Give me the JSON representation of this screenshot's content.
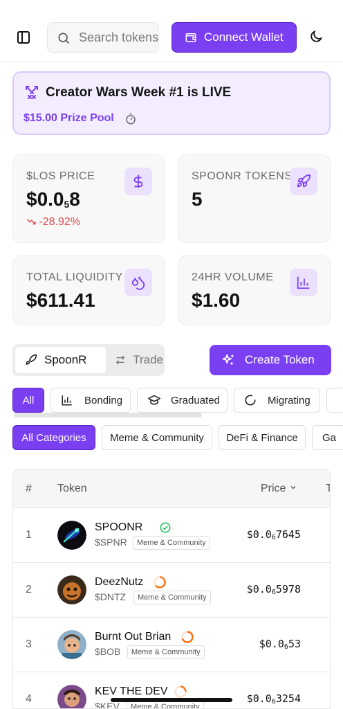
{
  "header": {
    "search_placeholder": "Search tokens",
    "connect_label": "Connect Wallet",
    "icons": [
      "sidebar-toggle-icon",
      "search-icon",
      "wallet-icon",
      "moon-icon"
    ]
  },
  "banner": {
    "title": "Creator Wars Week #1 is LIVE",
    "prize": "$15.00 Prize Pool",
    "icons": [
      "crossed-swords-icon",
      "timer-icon"
    ]
  },
  "stats": {
    "los_price": {
      "label": "$LOS PRICE",
      "value_prefix": "$0.0",
      "value_sub": "5",
      "value_suffix": "8",
      "change": "-28.92%",
      "icon": "dollar-icon"
    },
    "spoonr_tokens": {
      "label": "SPOONR TOKENS",
      "value": "5",
      "icon": "rocket-icon"
    },
    "total_liquidity": {
      "label": "TOTAL LIQUIDITY",
      "value": "$611.41",
      "icon": "droplets-icon"
    },
    "volume_24h": {
      "label": "24HR VOLUME",
      "value": "$1.60",
      "icon": "bar-chart-icon"
    }
  },
  "segmented": {
    "active": "SpoonR",
    "inactive": "Trade"
  },
  "create_token_label": "Create Token",
  "status_filters": [
    "All",
    "Bonding",
    "Graduated",
    "Migrating"
  ],
  "category_filters": [
    "All Categories",
    "Meme & Community",
    "DeFi & Finance",
    "Ga"
  ],
  "table": {
    "headers": {
      "rank": "#",
      "token": "Token",
      "price": "Price",
      "next": "T"
    },
    "rows": [
      {
        "rank": "1",
        "name": "SPOONR",
        "ticker": "$SPNR",
        "category": "Meme & Community",
        "price_prefix": "$0.0",
        "price_sub": "6",
        "price_suffix": "7645",
        "status": "verified"
      },
      {
        "rank": "2",
        "name": "DeezNutz",
        "ticker": "$DNTZ",
        "category": "Meme & Community",
        "price_prefix": "$0.0",
        "price_sub": "6",
        "price_suffix": "5978",
        "status": "bonding"
      },
      {
        "rank": "3",
        "name": "Burnt Out Brian",
        "ticker": "$BOB",
        "category": "Meme & Community",
        "price_prefix": "$0.0",
        "price_sub": "6",
        "price_suffix": "53",
        "status": "bonding"
      },
      {
        "rank": "4",
        "name": "KEV THE DEV",
        "ticker": "$KEV",
        "category": "Meme & Community",
        "price_prefix": "$0.0",
        "price_sub": "6",
        "price_suffix": "3254",
        "status": "bonding"
      }
    ]
  },
  "colors": {
    "accent": "#7b3ff2",
    "accent_light": "#ebe1fd",
    "negative": "#e5484d",
    "verified": "#22c55e",
    "bonding": "#f97316"
  }
}
